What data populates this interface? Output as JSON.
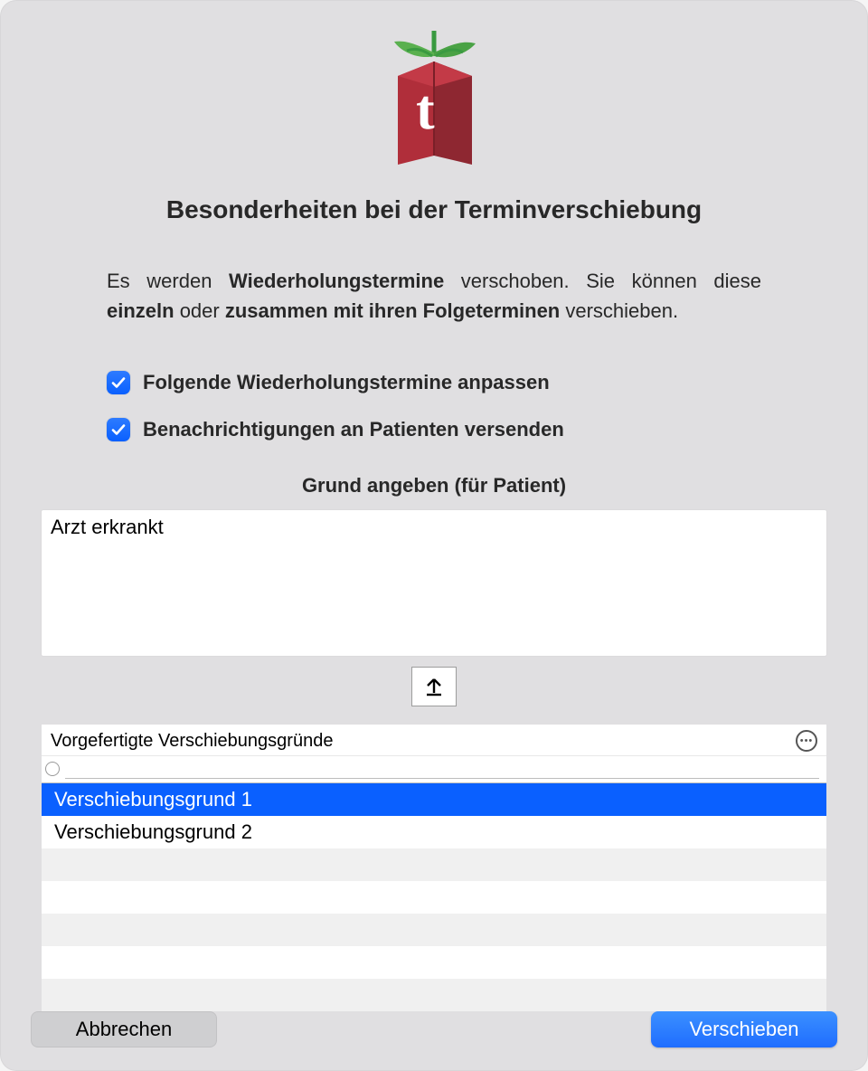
{
  "header": {
    "title": "Besonderheiten bei der Terminverschiebung"
  },
  "paragraph": {
    "p1": "Es werden ",
    "b1": "Wiederholungstermine",
    "p2": " verschoben. Sie können diese ",
    "b2": "einzeln",
    "p3": " oder ",
    "b3": "zusammen mit ihren Folgeterminen",
    "p4": " verschieben."
  },
  "options": {
    "adjust_following_label": "Folgende Wiederholungstermine anpassen",
    "adjust_following_checked": true,
    "notify_patients_label": "Benachrichtigungen an Patienten versenden",
    "notify_patients_checked": true
  },
  "reason": {
    "section_title": "Grund angeben (für Patient)",
    "value": "Arzt erkrankt"
  },
  "presets": {
    "header_label": "Vorgefertigte Verschiebungsgründe",
    "search_value": "",
    "items": [
      {
        "label": "Verschiebungsgrund 1",
        "selected": true
      },
      {
        "label": "Verschiebungsgrund 2",
        "selected": false
      }
    ],
    "blank_rows": 5
  },
  "buttons": {
    "cancel": "Abbrechen",
    "confirm": "Verschieben"
  },
  "icons": {
    "import_icon": "arrow-up-from-line",
    "more_icon": "ellipsis-circle"
  }
}
